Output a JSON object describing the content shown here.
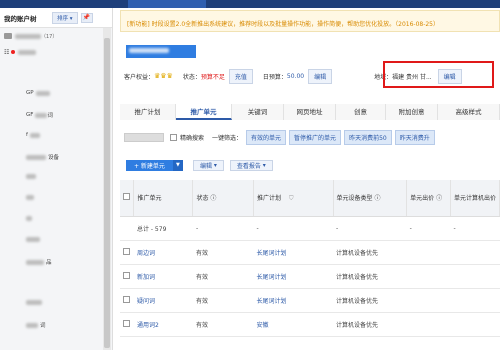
{
  "sidebar": {
    "title": "我的账户树",
    "sort_label": "排序",
    "pin_icon": "pin-icon",
    "account_suffix": "（17）",
    "units": [
      {
        "prefix": "GP",
        "suffix": ""
      },
      {
        "prefix": "GF",
        "suffix": "词"
      },
      {
        "prefix": "f",
        "suffix": ""
      },
      {
        "prefix": "",
        "suffix": "设备"
      },
      {
        "prefix": "",
        "suffix": ""
      },
      {
        "prefix": "",
        "suffix": ""
      },
      {
        "prefix": "",
        "suffix": ""
      },
      {
        "prefix": "",
        "suffix": ""
      },
      {
        "prefix": "",
        "suffix": "品"
      },
      {
        "prefix": "",
        "suffix": ""
      },
      {
        "prefix": "",
        "suffix": "词"
      }
    ]
  },
  "notice": {
    "text": "[新功能] 时段设置2.0全新推出系统建议，推荐时段以及批量操作功能，操作简便，帮助您优化投放。（2016-08-25）"
  },
  "info": {
    "budget_label": "客户权益：",
    "status_label": "状态：",
    "status_value": "预算不足",
    "recharge": "充值",
    "daily_budget_label": "日预算：",
    "daily_budget_value": "50.00",
    "edit": "编辑",
    "region_label": "地域：",
    "region_value": "福建 贵州 甘...",
    "region_edit": "编辑"
  },
  "tabs": [
    "推广计划",
    "推广单元",
    "关键词",
    "网页地址",
    "创意",
    "附加创意",
    "高级样式"
  ],
  "filters": {
    "precise_search": "精确搜索",
    "quick_filter": "一键筛选：",
    "buttons": [
      "有效的单元",
      "暂停推广的单元",
      "昨天消费前50",
      "昨天消费升"
    ]
  },
  "actions": {
    "new_unit": "+ 新建单元",
    "edit": "编辑",
    "report": "查看报告"
  },
  "table": {
    "headers": [
      "推广单元",
      "状态",
      "推广计划",
      "单元设备类型",
      "单元出价",
      "单元计算机出价"
    ],
    "total_label": "总计 - 579",
    "total_cells": [
      "-",
      "-",
      "-",
      "-",
      "-"
    ],
    "rows": [
      {
        "unit": "周边词",
        "status": "有效",
        "plan": "长尾词计划",
        "device": "计算机设备优先"
      },
      {
        "unit": "新加词",
        "status": "有效",
        "plan": "长尾词计划",
        "device": "计算机设备优先"
      },
      {
        "unit": "疑问词",
        "status": "有效",
        "plan": "长尾词计划",
        "device": "计算机设备优先"
      },
      {
        "unit": "通用词2",
        "status": "有效",
        "plan": "安徽",
        "device": "计算机设备优先"
      }
    ]
  },
  "colors": {
    "accent": "#2f7de1",
    "topbar": "#1e3f7a",
    "status_red": "#e01919",
    "notice_text": "#d88a00"
  }
}
